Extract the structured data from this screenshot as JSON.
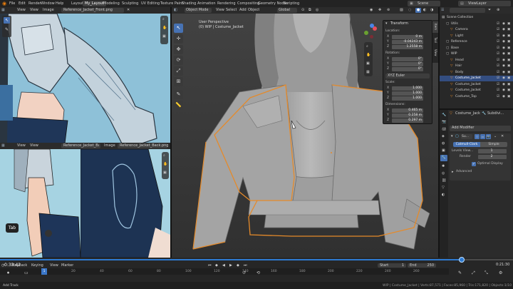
{
  "menu": {
    "items": [
      "File",
      "Edit",
      "Render",
      "Window",
      "Help"
    ],
    "workspaces": [
      "Layout",
      "My_Layout",
      "Modeling",
      "Sculpting",
      "UV Editing",
      "Texture Paint",
      "Shading",
      "Animation",
      "Rendering",
      "Compositing",
      "Geometry Nodes",
      "Scripting"
    ],
    "active_workspace": "My_Layout",
    "scene_label": "Scene",
    "view_layer_label": "ViewLayer"
  },
  "image_editor_top": {
    "menus": [
      "View",
      "View",
      "Image"
    ],
    "image_name": "Reference_Jacket_Front.png"
  },
  "image_editor_bottom": {
    "menus": [
      "View",
      "View",
      "Image"
    ],
    "image_name": "Reference_Jacket_Back.png"
  },
  "viewport": {
    "mode": "Object Mode",
    "menus": [
      "View",
      "Select",
      "Add",
      "Object"
    ],
    "transform_orientation": "Global",
    "overlay_title": "User Perspective",
    "overlay_object": "(0) WIP | Costume_Jacket",
    "tab_key_label": "Tab"
  },
  "n_panel": {
    "header": "Transform",
    "location_label": "Location:",
    "location": {
      "x": "0 m",
      "y": "-0.04243 m",
      "z": "1.2558 m"
    },
    "rotation_label": "Rotation:",
    "rotation": {
      "x": "0°",
      "y": "0°",
      "z": "0°"
    },
    "rotation_mode": "XYZ Euler",
    "scale_label": "Scale:",
    "scale": {
      "x": "1.000",
      "y": "1.000",
      "z": "1.000"
    },
    "dimensions_label": "Dimensions:",
    "dimensions": {
      "x": "0.465 m",
      "y": "0.258 m",
      "z": "0.297 m"
    },
    "side_tabs": [
      "Item",
      "Tool",
      "View"
    ]
  },
  "outliner": {
    "title": "Scene Collection",
    "items": [
      {
        "name": "Scene Collection",
        "indent": 0
      },
      {
        "name": "Utils",
        "indent": 1
      },
      {
        "name": "Camera",
        "indent": 2
      },
      {
        "name": "Light",
        "indent": 2
      },
      {
        "name": "Reference",
        "indent": 1
      },
      {
        "name": "Base",
        "indent": 1
      },
      {
        "name": "WIP",
        "indent": 1
      },
      {
        "name": "Head",
        "indent": 2
      },
      {
        "name": "Hair",
        "indent": 2
      },
      {
        "name": "Body",
        "indent": 2
      },
      {
        "name": "Costume_Jacket",
        "indent": 2,
        "selected": true
      },
      {
        "name": "Costume_Jacket",
        "indent": 2
      },
      {
        "name": "Costume_Jacket",
        "indent": 2
      },
      {
        "name": "Costume_Top",
        "indent": 2
      }
    ]
  },
  "properties": {
    "object_name": "Costume_Jacket",
    "modifier_tab": "Subdivi...",
    "add_modifier": "Add Modifier",
    "modifier_short": "Su...",
    "mode_options": [
      "Catmull-Clark",
      "Simple"
    ],
    "active_mode": "Catmull-Clark",
    "levels_viewport_label": "Levels View...",
    "levels_viewport": "1",
    "render_label": "Render",
    "render_levels": "2",
    "optimal_display": "Optimal Display",
    "advanced": "Advanced"
  },
  "timeline": {
    "current_time": "0:33:42",
    "total_time": "0:21:30",
    "menus": [
      "Playback",
      "Keying",
      "View",
      "Marker"
    ],
    "start_label": "Start",
    "start_value": "1",
    "end_label": "End",
    "end_value": "250",
    "frame_ticks": [
      "20",
      "40",
      "60",
      "80",
      "100",
      "120",
      "140",
      "160",
      "180",
      "200",
      "220",
      "240",
      "260"
    ],
    "progress_fraction": 0.9
  },
  "statusbar": {
    "left": "Add Track",
    "right": "WIP | Costume_Jacket | Verts:87,571 | Faces:85,960 | Tris:171,820 | Objects:1/10"
  },
  "colors": {
    "accent_blue": "#4772b3",
    "selection_orange": "#e58a2a",
    "timeline_blue": "#2e7ad1"
  }
}
